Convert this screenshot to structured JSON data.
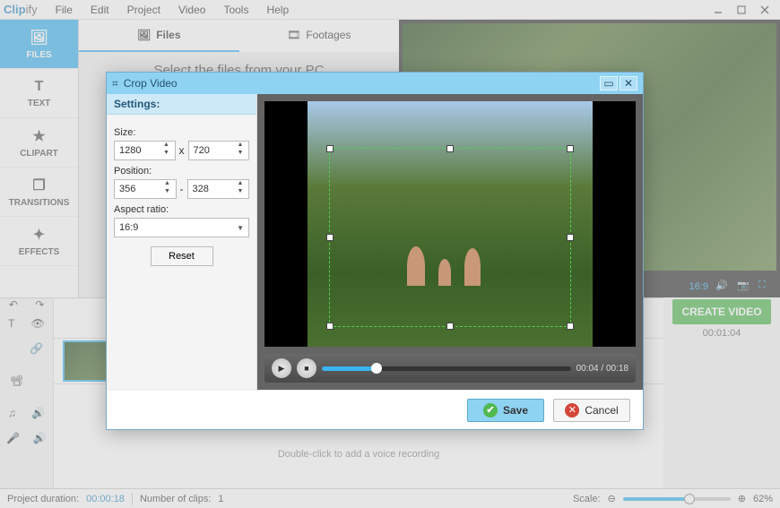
{
  "app": {
    "name_prefix": "Clip",
    "name_suffix": "ify"
  },
  "menu": [
    "File",
    "Edit",
    "Project",
    "Video",
    "Tools",
    "Help"
  ],
  "sidebar": {
    "items": [
      {
        "label": "FILES",
        "icon": "🖼"
      },
      {
        "label": "TEXT",
        "icon": "T"
      },
      {
        "label": "CLIPART",
        "icon": "★"
      },
      {
        "label": "TRANSITIONS",
        "icon": "❐"
      },
      {
        "label": "EFFECTS",
        "icon": "✦"
      }
    ]
  },
  "subtabs": {
    "files": "Files",
    "footages": "Footages"
  },
  "center_prompt": "Select the files from your PC",
  "preview": {
    "aspect_label": "16:9"
  },
  "create_button": "CREATE VIDEO",
  "project_time": "00:01:04",
  "timeline": {
    "voice_hint": "Double-click to add a voice recording"
  },
  "status": {
    "duration_label": "Project duration:",
    "duration_value": "00:00:18",
    "clips_label": "Number of clips:",
    "clips_value": "1",
    "scale_label": "Scale:",
    "scale_value": "62%"
  },
  "dialog": {
    "title": "Crop Video",
    "settings_header": "Settings:",
    "size_label": "Size:",
    "size_w": "1280",
    "size_h": "720",
    "size_sep": "x",
    "position_label": "Position:",
    "pos_x": "356",
    "pos_y": "328",
    "pos_sep": "-",
    "aspect_label": "Aspect ratio:",
    "aspect_value": "16:9",
    "reset": "Reset",
    "playback": {
      "current": "00:04",
      "total": "00:18",
      "sep": " / "
    },
    "save": "Save",
    "cancel": "Cancel"
  }
}
